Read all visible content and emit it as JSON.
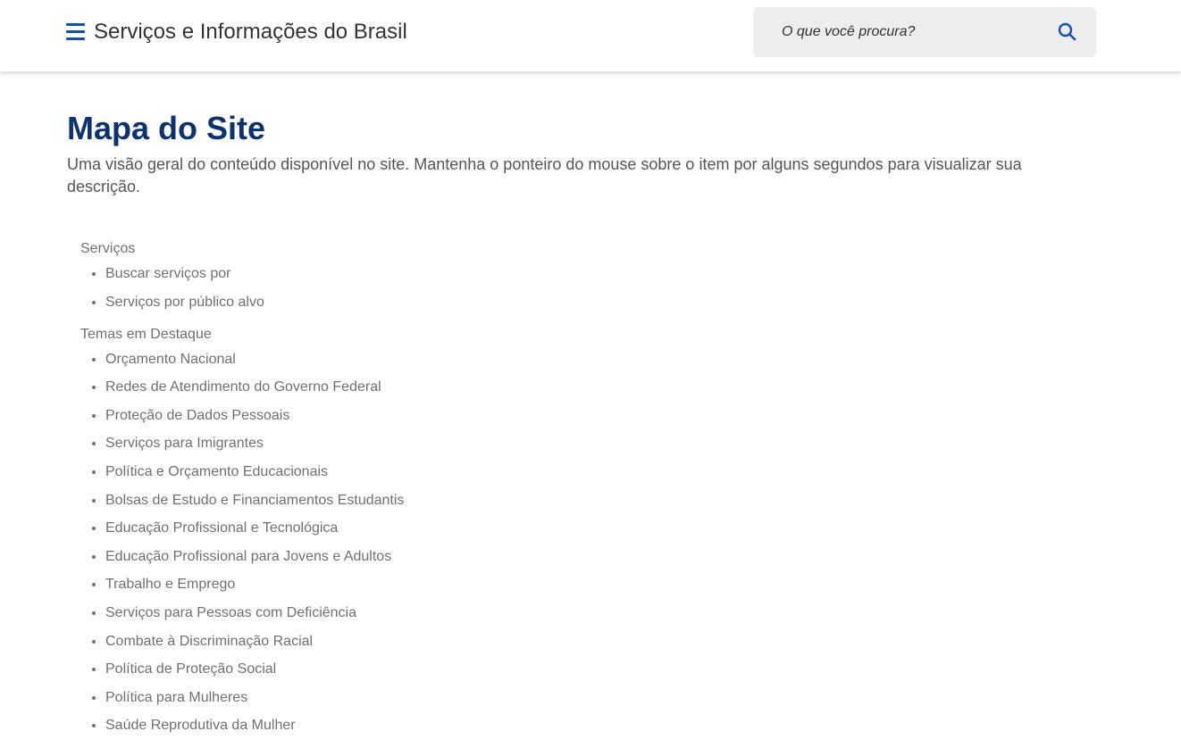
{
  "header": {
    "site_title": "Serviços e Informações do Brasil",
    "menu_icon": "hamburger-menu-icon",
    "search": {
      "placeholder": "O que você procura?",
      "value": "",
      "icon": "search-icon"
    }
  },
  "page": {
    "title": "Mapa do Site",
    "description": "Uma visão geral do conteúdo disponível no site. Mantenha o ponteiro do mouse sobre o item por alguns segundos para visualizar sua descrição."
  },
  "sitemap": {
    "sections": [
      {
        "title": "Serviços",
        "items": [
          "Buscar serviços por",
          "Serviços por público alvo"
        ]
      },
      {
        "title": "Temas em Destaque",
        "items": [
          "Orçamento Nacional",
          "Redes de Atendimento do Governo Federal",
          "Proteção de Dados Pessoais",
          "Serviços para Imigrantes",
          "Política e Orçamento Educacionais",
          "Bolsas de Estudo e Financiamentos Estudantis",
          "Educação Profissional e Tecnológica",
          "Educação Profissional para Jovens e Adultos",
          "Trabalho e Emprego",
          "Serviços para Pessoas com Deficiência",
          "Combate à Discriminação Racial",
          "Política de Proteção Social",
          "Política para Mulheres",
          "Saúde Reprodutiva da Mulher"
        ]
      }
    ]
  },
  "colors": {
    "brand_blue": "#1351b4",
    "title_blue": "#0c326f",
    "link_gray": "#707070"
  }
}
